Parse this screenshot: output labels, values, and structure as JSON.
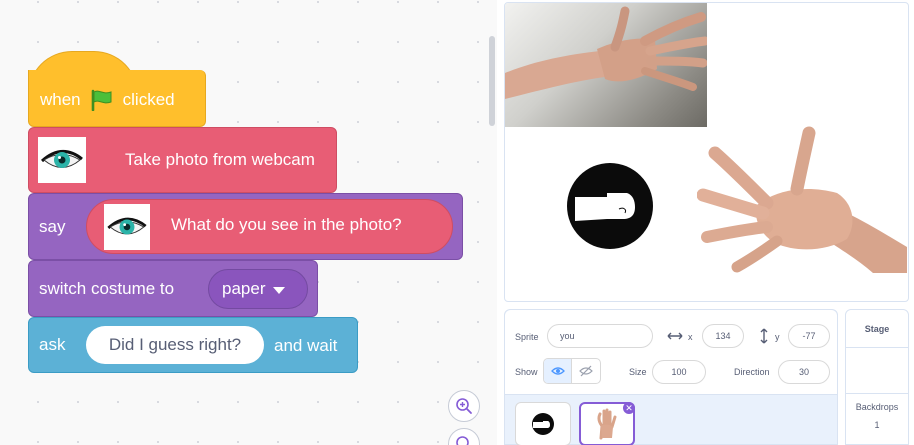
{
  "code_blocks": {
    "hat": {
      "when": "when",
      "clicked": "clicked",
      "flag_icon": "green-flag-icon"
    },
    "take_photo": {
      "label": "Take photo from webcam",
      "icon": "eye-icon"
    },
    "say": {
      "label": "say",
      "text": "What do you see in the photo?",
      "icon": "eye-icon"
    },
    "switch_costume": {
      "label": "switch costume to",
      "value": "paper"
    },
    "ask": {
      "label": "ask",
      "question": "Did I guess right?",
      "tail": "and wait"
    }
  },
  "colors": {
    "events": "#ffbf2c",
    "ml_extension": "#e85d75",
    "looks": "#9565c1",
    "sensing": "#5cb1d6",
    "selected": "#855cd6"
  },
  "zoom_controls": {
    "zoom_in_icon": "zoom-in-icon",
    "reset_icon": "zoom-reset-icon"
  },
  "sprite_info": {
    "sprite_label": "Sprite",
    "name": "you",
    "x_label": "x",
    "x": "134",
    "y_label": "y",
    "y": "-77",
    "show_label": "Show",
    "size_label": "Size",
    "size": "100",
    "direction_label": "Direction",
    "direction": "30"
  },
  "stage_selector": {
    "title": "Stage",
    "backdrops_label": "Backdrops",
    "backdrops_count": "1"
  }
}
